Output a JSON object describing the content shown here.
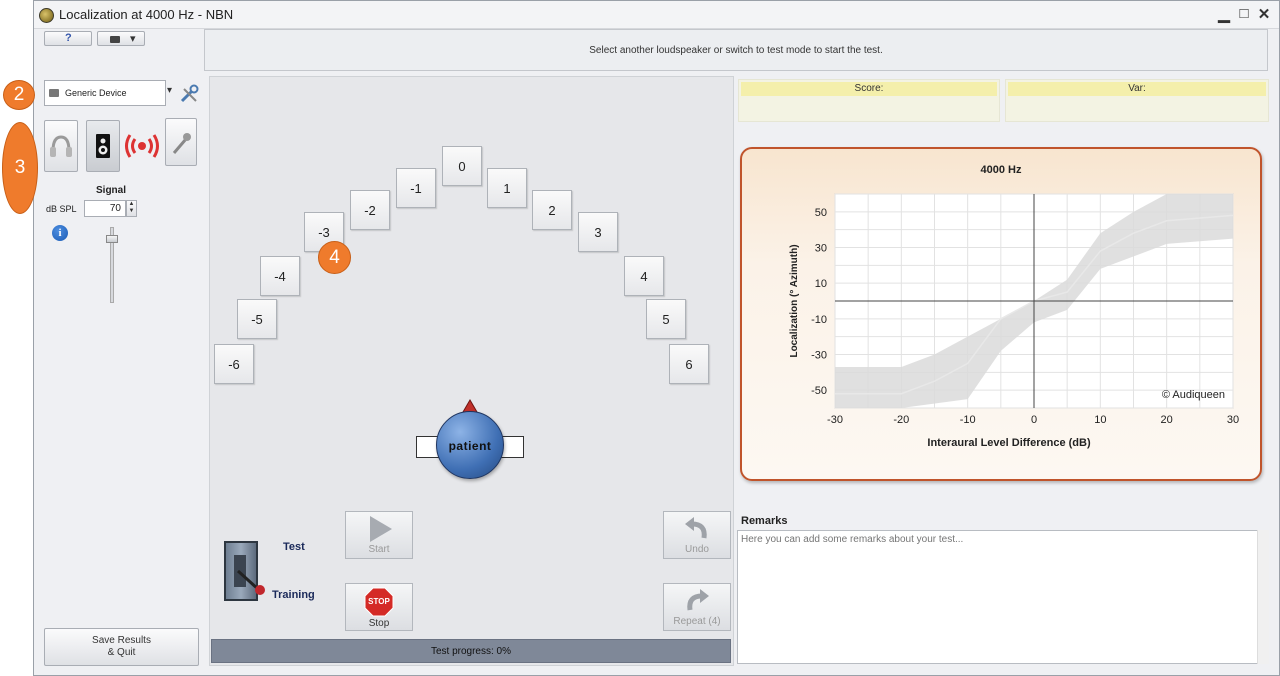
{
  "window": {
    "title": "Localization at 4000 Hz - NBN",
    "controls": {
      "minimize": "▁",
      "maximize": "□",
      "close": "✕"
    }
  },
  "toolbar": {
    "help_icon": "question-mark-icon",
    "camera_icon": "video-camera-icon",
    "dropdown_glyph": "▾"
  },
  "status_message": "Select another loudspeaker or switch to test mode to start the test.",
  "device": {
    "selected": "Generic Device"
  },
  "signal": {
    "heading": "Signal",
    "unit_label": "dB SPL",
    "value": "70"
  },
  "speakers": [
    "0",
    "-1",
    "1",
    "-2",
    "2",
    "-3",
    "3",
    "-4",
    "4",
    "-5",
    "5",
    "-6",
    "6"
  ],
  "patient_label": "patient",
  "mode": {
    "test": "Test",
    "training": "Training"
  },
  "buttons": {
    "start": "Start",
    "stop": "Stop",
    "stop_sign": "STOP",
    "undo": "Undo",
    "repeat": "Repeat (4)",
    "save_quit": "Save Results\n& Quit"
  },
  "progress": {
    "label": "Test progress: 0%",
    "value": 0
  },
  "score": {
    "score_label": "Score:",
    "var_label": "Var:"
  },
  "remarks": {
    "label": "Remarks",
    "placeholder": "Here you can add some remarks about your test..."
  },
  "badges": {
    "b2": "2",
    "b3": "3",
    "b4": "4"
  },
  "colors": {
    "badge": "#ef7b2c",
    "chart_border": "#c0542b",
    "score_header": "#f4efab",
    "progress_bar": "#7f8898"
  },
  "chart_data": {
    "type": "area",
    "title": "4000 Hz",
    "xlabel": "Interaural Level Difference (dB)",
    "ylabel": "Localization (° Azimuth)",
    "x_ticks": [
      "-30",
      "-20",
      "-10",
      "0",
      "10",
      "20",
      "30"
    ],
    "y_ticks": [
      "50",
      "30",
      "10",
      "-10",
      "-30",
      "-50"
    ],
    "xlim": [
      -30,
      30
    ],
    "ylim": [
      -60,
      60
    ],
    "grid": true,
    "watermark": "© Audiqueen",
    "band_upper": [
      [
        -30,
        -37
      ],
      [
        -20,
        -37
      ],
      [
        -15,
        -30
      ],
      [
        -10,
        -20
      ],
      [
        0,
        0
      ],
      [
        5,
        12
      ],
      [
        10,
        38
      ],
      [
        15,
        50
      ],
      [
        20,
        60
      ],
      [
        30,
        60
      ]
    ],
    "band_lower": [
      [
        -30,
        -60
      ],
      [
        -20,
        -60
      ],
      [
        -10,
        -55
      ],
      [
        -5,
        -28
      ],
      [
        0,
        -12
      ],
      [
        5,
        -5
      ],
      [
        10,
        18
      ],
      [
        20,
        32
      ],
      [
        30,
        35
      ]
    ],
    "median_line": [
      [
        -30,
        -52
      ],
      [
        -20,
        -52
      ],
      [
        -15,
        -45
      ],
      [
        -10,
        -35
      ],
      [
        -5,
        -10
      ],
      [
        0,
        0
      ],
      [
        5,
        5
      ],
      [
        10,
        28
      ],
      [
        15,
        38
      ],
      [
        20,
        45
      ],
      [
        30,
        48
      ]
    ]
  }
}
